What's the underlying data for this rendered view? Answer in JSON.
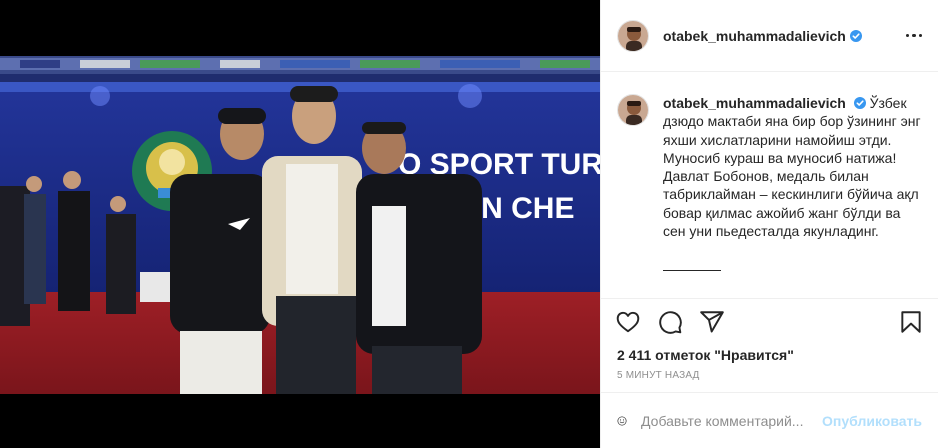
{
  "post": {
    "username": "otabek_muhammadalievich",
    "caption": "Ўзбек дзюдо мактаби яна бир бор ўзининг энг яхши хислатларини намойиш этди. Муносиб кураш ва муносиб натижа! Давлат Бобонов, медаль билан табриклайман – кескинлиги бўйича ақл бовар қилмас ажойиб жанг бўлди ва сен уни пьедесталда якунладинг.",
    "likes": "2 411 отметок \"Нравится\"",
    "time": "5 минут назад"
  },
  "photo": {
    "banner_text_1": "O SPORT TUR",
    "banner_text_2": "STON CHE"
  },
  "comment_box": {
    "placeholder": "Добавьте комментарий...",
    "publish_label": "Опубликовать"
  },
  "colors": {
    "verified": "#3897f0",
    "banner": "#1b2a7a",
    "floor": "#b3262b"
  },
  "icons": [
    "more-options-icon",
    "verified-badge-icon",
    "heart-icon",
    "comment-icon",
    "share-icon",
    "bookmark-icon",
    "emoji-icon"
  ]
}
